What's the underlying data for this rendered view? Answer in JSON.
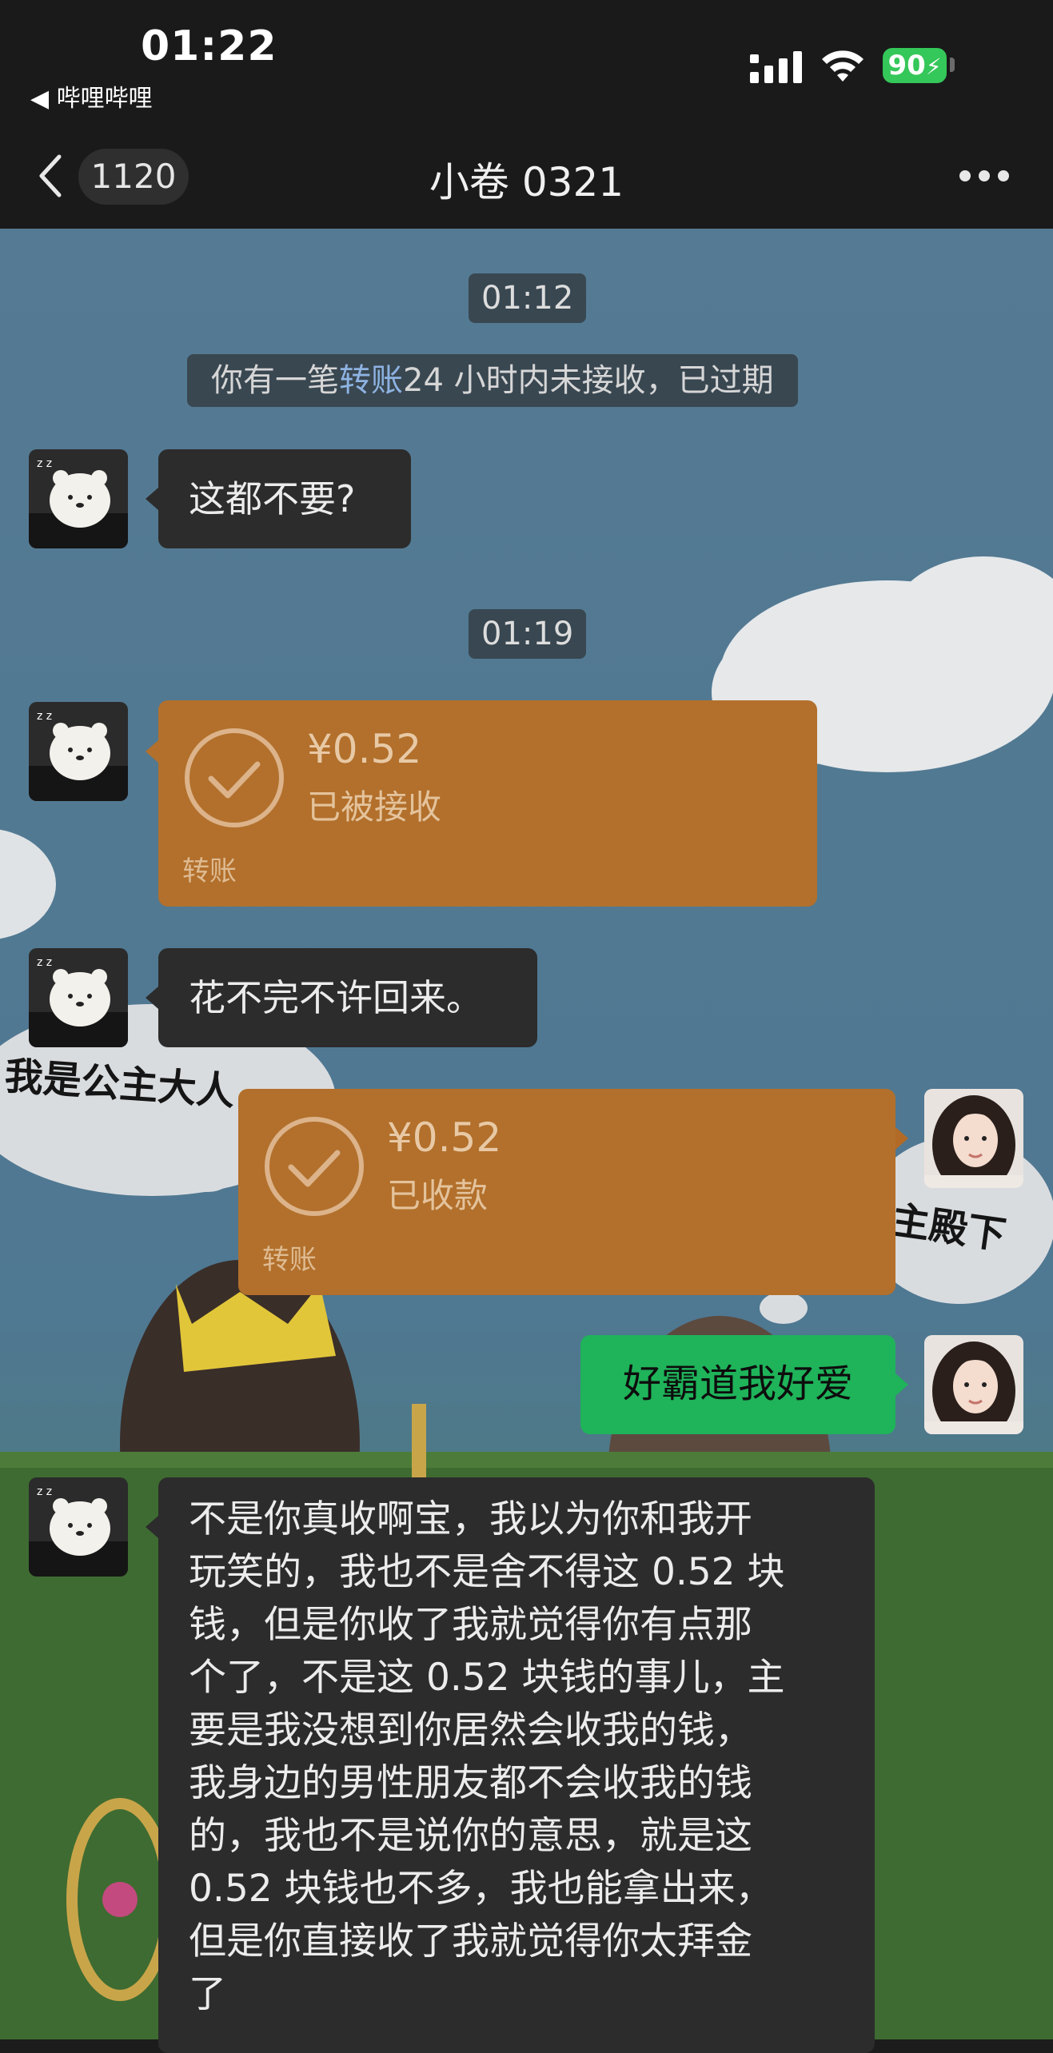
{
  "status_bar": {
    "time": "01:22",
    "back_app": "◀ 哔哩哔哩",
    "battery": "90"
  },
  "nav": {
    "unread_count": "1120",
    "title": "小卷 0321"
  },
  "messages": {
    "time1": "01:12",
    "system_prefix": "你有一笔",
    "system_link": "转账",
    "system_suffix": "24 小时内未接收，已过期",
    "msg1": "这都不要?",
    "time2": "01:19",
    "transfer1": {
      "amount": "¥0.52",
      "status": "已被接收",
      "label": "转账"
    },
    "msg2": "花不完不许回来。",
    "transfer2": {
      "amount": "¥0.52",
      "status": "已收款",
      "label": "转账"
    },
    "msg3": "好霸道我好爱",
    "msg4_lines": [
      "不是你真收啊宝，我以为你和我开",
      "玩笑的，我也不是舍不得这 0.52 块",
      "钱，但是你收了我就觉得你有点那",
      "个了，不是这 0.52 块钱的事儿，主",
      "要是我没想到你居然会收我的钱，",
      "我身边的男性朋友都不会收我的钱",
      "的，我也不是说你的意思，就是这",
      "0.52 块钱也不多，我也能拿出来，",
      "但是你直接收了我就觉得你太拜金",
      "了"
    ]
  },
  "wallpaper": {
    "cloud_text_left": "我是公主大人",
    "cloud_text_right": "主殿下"
  },
  "colors": {
    "topbar": "#1a1a1a",
    "incoming_bubble": "#2c2c2c",
    "outgoing_bubble": "#1fb35a",
    "transfer_bubble": "#b2702c"
  }
}
